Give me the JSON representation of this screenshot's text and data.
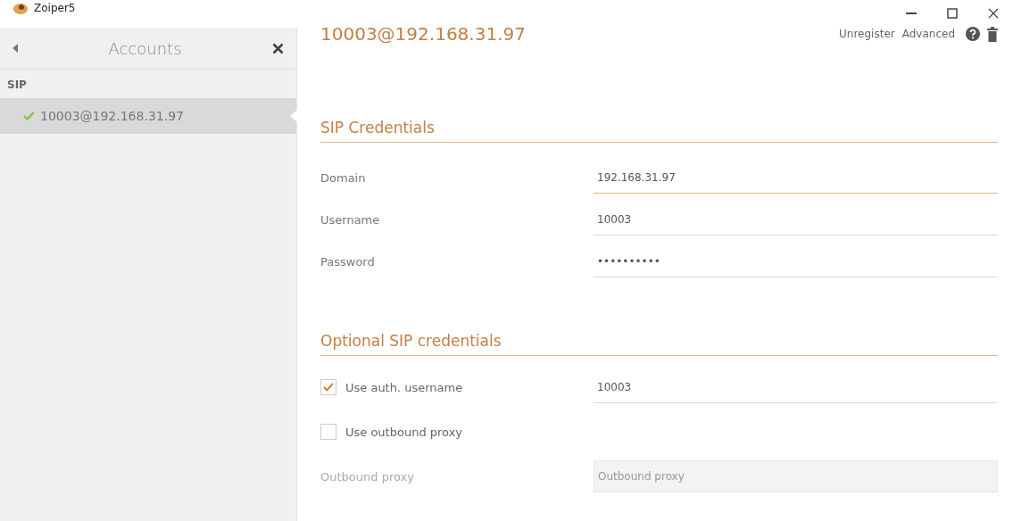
{
  "window": {
    "title": "Zoiper5"
  },
  "sidebar": {
    "title": "Accounts",
    "section": "SIP",
    "items": [
      {
        "label": "10003@192.168.31.97",
        "registered": true,
        "selected": true
      }
    ]
  },
  "account": {
    "title": "10003@192.168.31.97",
    "actions": [
      "Unregister",
      "Advanced"
    ]
  },
  "sip_credentials": {
    "title": "SIP Credentials",
    "fields": [
      {
        "label": "Domain",
        "value": "192.168.31.97",
        "focused": true
      },
      {
        "label": "Username",
        "value": "10003",
        "focused": false
      },
      {
        "label": "Password",
        "value": "••••••••••",
        "focused": false
      }
    ]
  },
  "optional_credentials": {
    "title": "Optional SIP credentials",
    "rows": [
      {
        "kind": "checkbox",
        "label": "Use auth. username",
        "checked": true,
        "value": "10003"
      },
      {
        "kind": "checkbox",
        "label": "Use outbound proxy",
        "checked": false
      },
      {
        "kind": "field",
        "label": "Outbound proxy",
        "placeholder": "Outbound proxy",
        "disabled": true
      }
    ]
  }
}
